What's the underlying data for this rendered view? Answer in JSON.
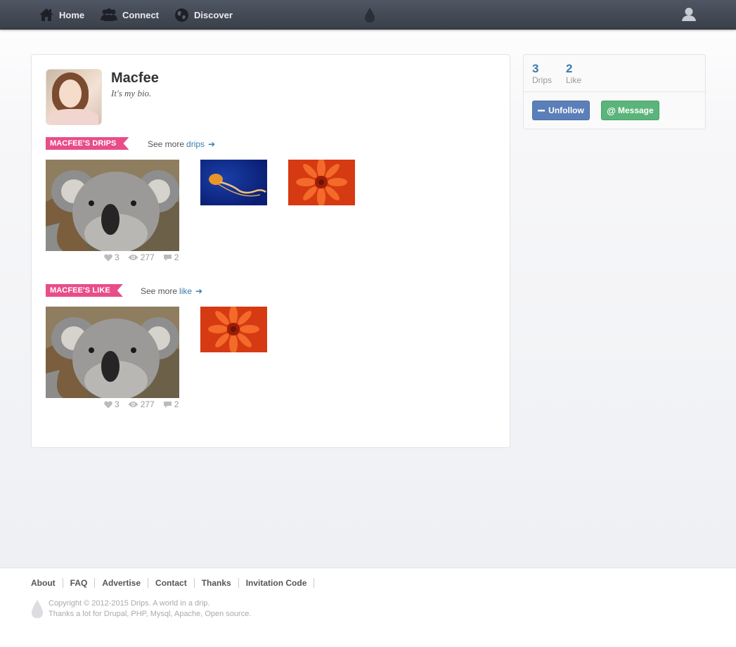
{
  "nav": {
    "home": "Home",
    "connect": "Connect",
    "discover": "Discover"
  },
  "profile": {
    "name": "Macfee",
    "bio": "It's my bio."
  },
  "drips_section": {
    "title": "MACFEE'S DRIPS",
    "see_more_prefix": "See more",
    "see_more_link": "drips",
    "featured_stats": {
      "likes": "3",
      "views": "277",
      "comments": "2"
    }
  },
  "like_section": {
    "title": "MACFEE'S LIKE",
    "see_more_prefix": "See more",
    "see_more_link": "like",
    "featured_stats": {
      "likes": "3",
      "views": "277",
      "comments": "2"
    }
  },
  "sidebar": {
    "drips_count": "3",
    "drips_label": "Drips",
    "like_count": "2",
    "like_label": "Like",
    "unfollow_label": "Unfollow",
    "message_label": "Message"
  },
  "footer": {
    "links": [
      "About",
      "FAQ",
      "Advertise",
      "Contact",
      "Thanks",
      "Invitation Code"
    ],
    "copyright": "Copyright © 2012-2015 Drips. A world in a drip.",
    "thanks": "Thanks a lot for Drupal, PHP, Mysql, Apache, Open source."
  },
  "colors": {
    "accent_link": "#3a7bb0",
    "ribbon": "#e84d8a",
    "unfollow_button": "#5b7fb8",
    "message_button": "#5bb47a",
    "nav_bg": "#454b56"
  }
}
